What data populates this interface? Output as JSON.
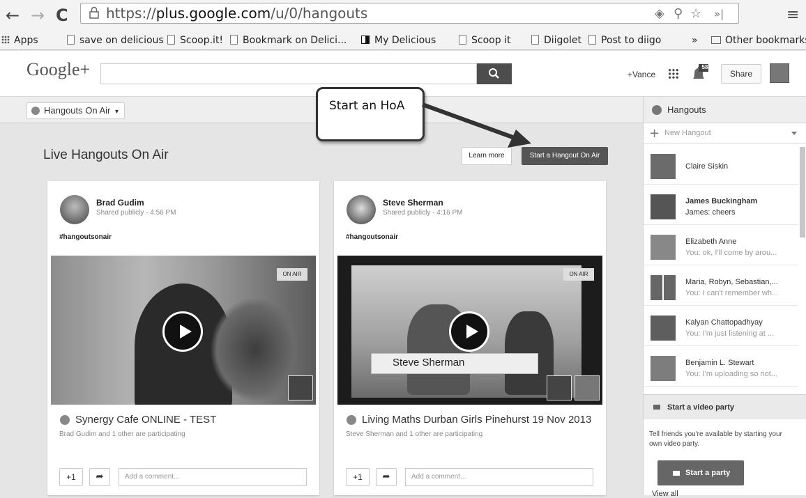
{
  "browser": {
    "url_prefix": "https://",
    "url_host": "plus.google.com",
    "url_path": "/u/0/hangouts",
    "bookmarks": [
      "Apps",
      "save on delicious",
      "Scoop.it!",
      "Bookmark on Delici...",
      "My Delicious",
      "Scoop it",
      "Diigolet",
      "Post to diigo"
    ],
    "overflow": "»",
    "other_bookmarks": "Other bookmarks"
  },
  "header": {
    "logo": "Google+",
    "user_link": "+Vance",
    "notif_count": "58",
    "share_label": "Share"
  },
  "subheader": {
    "dropdown_label": "Hangouts On Air"
  },
  "callout": {
    "text": "Start an HoA"
  },
  "main": {
    "title": "Live Hangouts On Air",
    "learn_more": "Learn more",
    "start_hoa": "Start a Hangout On Air",
    "cards": [
      {
        "name": "Brad Gudim",
        "meta": "Shared publicly  -  4:56 PM",
        "tag": "#hangoutsonair",
        "onair": "ON AIR",
        "title": "Synergy Cafe ONLINE - TEST",
        "sub": "Brad Gudim and 1 other are participating",
        "plus1": "+1",
        "comment_placeholder": "Add a comment..."
      },
      {
        "name": "Steve Sherman",
        "meta": "Shared publicly  -  4:16 PM",
        "tag": "#hangoutsonair",
        "onair": "ON AIR",
        "video_name": "Steve Sherman",
        "title": "Living Maths Durban Girls Pinehurst 19 Nov 2013",
        "sub": "Steve Sherman and 1 other are participating",
        "plus1": "+1",
        "comment_placeholder": "Add a comment..."
      }
    ]
  },
  "hangouts": {
    "title": "Hangouts",
    "new_hangout": "New Hangout",
    "contacts": [
      {
        "name": "Claire Siskin",
        "msg": "",
        "bold": false
      },
      {
        "name": "James Buckingham",
        "msg": "James: cheers",
        "bold": true
      },
      {
        "name": "Elizabeth Anne",
        "msg": "You: ok, I'll come by arou...",
        "bold": false
      },
      {
        "name": "Maria, Robyn, Sebastian,...",
        "msg": "You: I can't remember wh...",
        "bold": false
      },
      {
        "name": "Kalyan Chattopadhyay",
        "msg": "You: I'm just listening at ...",
        "bold": false
      },
      {
        "name": "Benjamin L. Stewart",
        "msg": "You: I'm uploading so not...",
        "bold": false
      }
    ],
    "video_party_title": "Start a video party",
    "video_party_text": "Tell friends you're available by starting your own video party.",
    "start_party": "Start a party",
    "view_all": "View all"
  }
}
